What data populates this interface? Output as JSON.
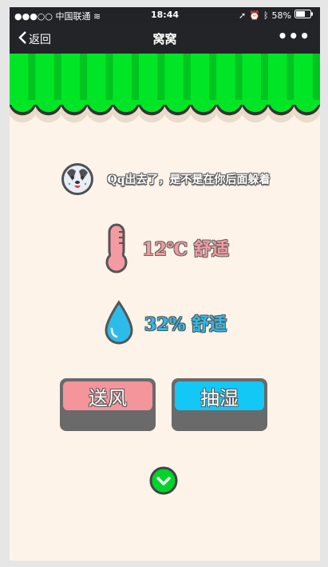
{
  "status": {
    "carrier": "●●●○○ 中国联通",
    "time": "18:44",
    "battery": "58%"
  },
  "nav": {
    "back_label": "返回",
    "title": "窝窝",
    "more": "•••"
  },
  "message": "Qq出去了，是不是在你后面躲着",
  "temperature": {
    "value": "12℃",
    "status": "舒适"
  },
  "humidity": {
    "value": "32%",
    "status": "舒适"
  },
  "buttons": {
    "fan": "送风",
    "dehumidify": "抽湿"
  },
  "colors": {
    "awning_green": "#00e626",
    "pink": "#f49aa2",
    "blue": "#13c8f6",
    "background": "#fdf3e8"
  },
  "icons": [
    "back-chevron-icon",
    "more-icon",
    "dog-avatar-icon",
    "thermometer-icon",
    "water-drop-icon",
    "chevron-down-icon"
  ]
}
